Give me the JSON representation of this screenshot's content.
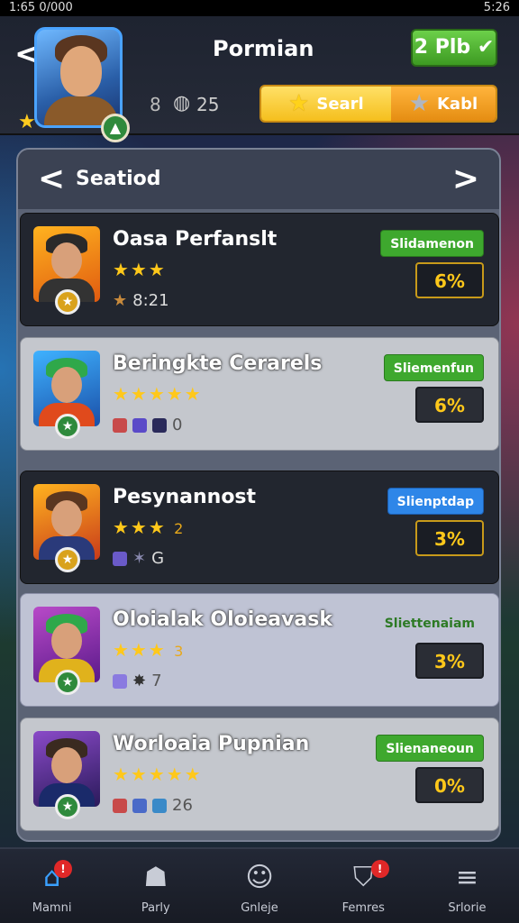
{
  "status_bar": {
    "left": "1:65 0/000",
    "right": "5:26"
  },
  "header": {
    "back_glyph": "<",
    "player_name": "Pormian",
    "level": "8",
    "count": "25",
    "coins_label": "2 Plb",
    "coins_icon": "check-icon",
    "tabs": [
      {
        "label": "Searl",
        "icon": "star-icon"
      },
      {
        "label": "Kabl",
        "icon": "star-icon"
      }
    ]
  },
  "panel": {
    "title": "Seatiod",
    "prev_glyph": "<",
    "next_glyph": ">"
  },
  "cards": [
    {
      "name": "Oasa Perfanslt",
      "stars": "★★★",
      "stars_extra": "",
      "meta_text": "8:21",
      "status": "Slidamenon",
      "status_color": "green",
      "pct": "6%",
      "theme": "dark"
    },
    {
      "name": "Beringkte Cerarels",
      "stars": "★★★★★",
      "stars_extra": "",
      "meta_text": "0",
      "status": "Sliemenfun",
      "status_color": "green",
      "pct": "6%",
      "theme": "light"
    },
    {
      "name": "Pesynannost",
      "stars": "★★★",
      "stars_extra": "2",
      "meta_text": "G",
      "status": "Slienptdap",
      "status_color": "blue",
      "pct": "3%",
      "theme": "dark"
    },
    {
      "name": "Oloialak Oloieavask",
      "stars": "★★★",
      "stars_extra": "3",
      "meta_text": "7",
      "status": "Sliettenaiam",
      "status_color": "plain",
      "pct": "3%",
      "theme": "lilac"
    },
    {
      "name": "Worloaia Pupnian",
      "stars": "★★★★★",
      "stars_extra": "",
      "meta_text": "26",
      "status": "Slienaneoun",
      "status_color": "green",
      "pct": "0%",
      "theme": "light"
    }
  ],
  "bottom_nav": [
    {
      "label": "Mamni",
      "icon": "home-icon",
      "badge": "!",
      "active": true
    },
    {
      "label": "Parly",
      "icon": "fox-icon",
      "badge": "",
      "active": false
    },
    {
      "label": "Gnleje",
      "icon": "smiley-icon",
      "badge": "",
      "active": false
    },
    {
      "label": "Femres",
      "icon": "shield-icon",
      "badge": "!",
      "active": false
    },
    {
      "label": "Srlorie",
      "icon": "menu-icon",
      "badge": "",
      "active": false
    }
  ],
  "colors": {
    "accent_green": "#3ea82e",
    "accent_blue": "#2e86e8",
    "gold": "#ffc81a",
    "nav_active": "#3aa0ff"
  }
}
